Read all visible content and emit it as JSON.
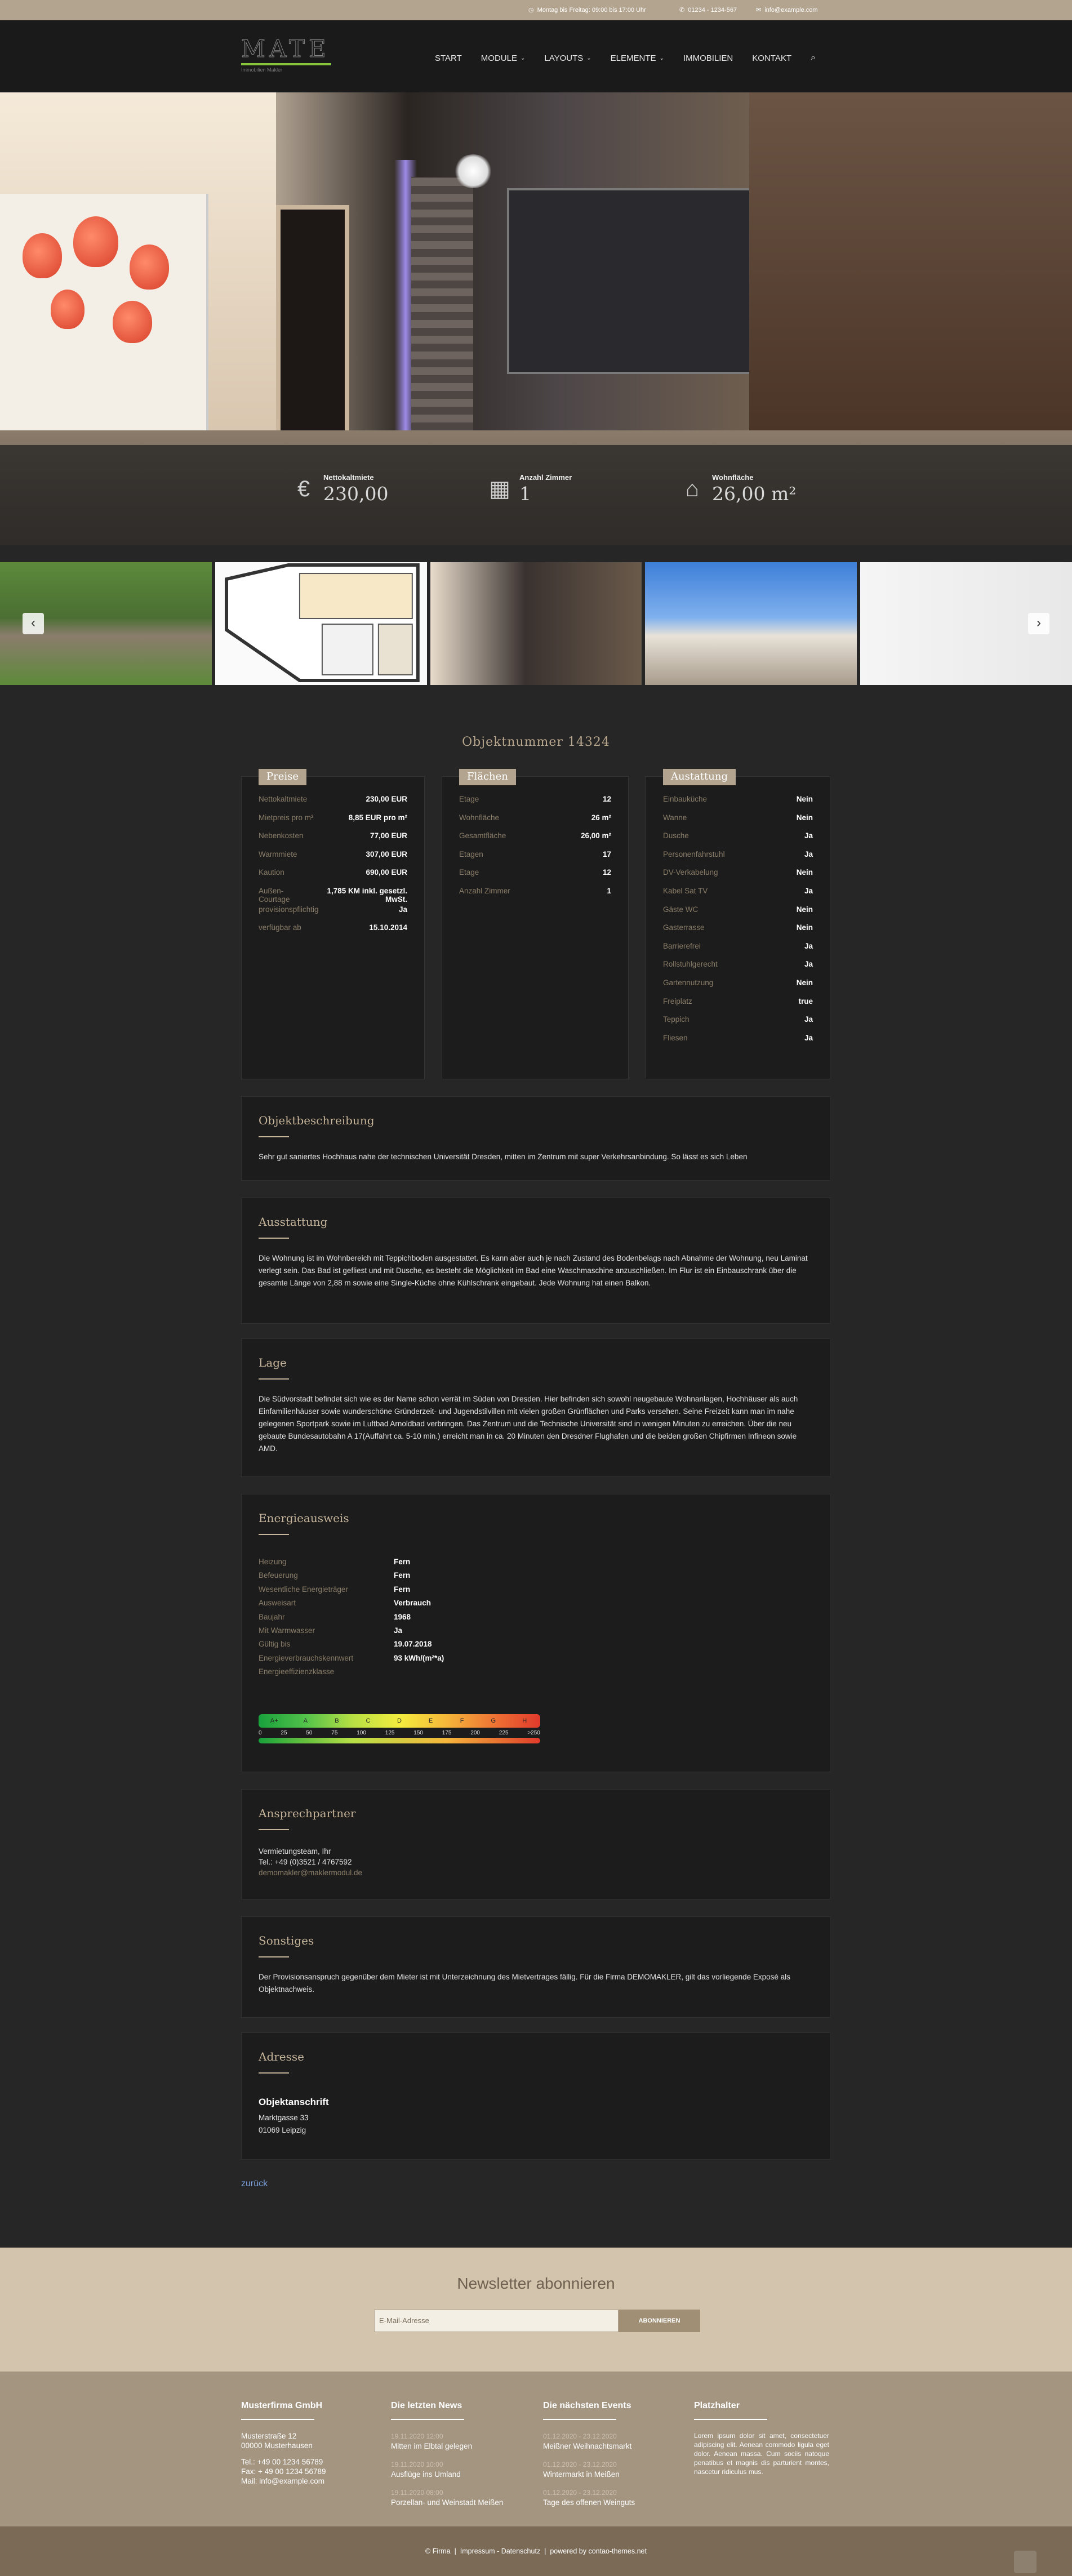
{
  "topbar": {
    "hours": "Montag bis Freitag: 09:00 bis 17:00 Uhr",
    "phone": "01234 - 1234-567",
    "email": "info@example.com"
  },
  "logo": {
    "text": "MATE",
    "tagline": "Immobilien Makler"
  },
  "nav": [
    "START",
    "MODULE",
    "LAYOUTS",
    "ELEMENTE",
    "IMMOBILIEN",
    "KONTAKT"
  ],
  "hero_stats": [
    {
      "label": "Nettokaltmiete",
      "value": "230,00"
    },
    {
      "label": "Anzahl Zimmer",
      "value": "1"
    },
    {
      "label": "Wohnfläche",
      "value": "26,00 m²"
    }
  ],
  "object_number": "Objektnummer 14324",
  "preise": {
    "title": "Preise",
    "rows": [
      {
        "k": "Nettokaltmiete",
        "v": "230,00 EUR"
      },
      {
        "k": "Mietpreis pro m²",
        "v": "8,85 EUR pro m²"
      },
      {
        "k": "Nebenkosten",
        "v": "77,00 EUR"
      },
      {
        "k": "Warmmiete",
        "v": "307,00 EUR"
      },
      {
        "k": "Kaution",
        "v": "690,00 EUR"
      },
      {
        "k": "Außen-Courtage",
        "v": "1,785 KM inkl. gesetzl. MwSt."
      },
      {
        "k": "provisionspflichtig",
        "v": "Ja"
      },
      {
        "k": "verfügbar ab",
        "v": "15.10.2014"
      }
    ]
  },
  "flaechen": {
    "title": "Flächen",
    "rows": [
      {
        "k": "Etage",
        "v": "12"
      },
      {
        "k": "Wohnfläche",
        "v": "26 m²"
      },
      {
        "k": "Gesamtfläche",
        "v": "26,00 m²"
      },
      {
        "k": "Etagen",
        "v": "17"
      },
      {
        "k": "Etage",
        "v": "12"
      },
      {
        "k": "Anzahl Zimmer",
        "v": "1"
      }
    ]
  },
  "ausstattung_box": {
    "title": "Austattung",
    "rows": [
      {
        "k": "Einbauküche",
        "v": "Nein"
      },
      {
        "k": "Wanne",
        "v": "Nein"
      },
      {
        "k": "Dusche",
        "v": "Ja"
      },
      {
        "k": "Personenfahrstuhl",
        "v": "Ja"
      },
      {
        "k": "DV-Verkabelung",
        "v": "Nein"
      },
      {
        "k": "Kabel Sat TV",
        "v": "Ja"
      },
      {
        "k": "Gäste WC",
        "v": "Nein"
      },
      {
        "k": "Gasterrasse",
        "v": "Nein"
      },
      {
        "k": "Barrierefrei",
        "v": "Ja"
      },
      {
        "k": "Rollstuhlgerecht",
        "v": "Ja"
      },
      {
        "k": "Gartennutzung",
        "v": "Nein"
      },
      {
        "k": "Freiplatz",
        "v": "true"
      },
      {
        "k": "Teppich",
        "v": "Ja"
      },
      {
        "k": "Fliesen",
        "v": "Ja"
      }
    ]
  },
  "sections": {
    "beschreibung": {
      "title": "Objektbeschreibung",
      "text": "Sehr gut saniertes Hochhaus nahe der technischen Universität Dresden, mitten im Zentrum mit super Verkehrsanbindung. So lässt es sich Leben"
    },
    "ausstattung": {
      "title": "Ausstattung",
      "text": "Die Wohnung ist im Wohnbereich mit Teppichboden ausgestattet. Es kann aber auch je nach Zustand des Bodenbelags nach Abnahme der Wohnung, neu Laminat verlegt sein. Das Bad ist gefliest und mit Dusche, es besteht die Möglichkeit im Bad eine Waschmaschine anzuschließen. Im Flur ist ein Einbauschrank über die gesamte Länge von 2,88 m sowie eine Single-Küche ohne Kühlschrank eingebaut. Jede Wohnung hat einen Balkon."
    },
    "lage": {
      "title": "Lage",
      "text": "Die Südvorstadt befindet sich wie es der Name schon verrät im Süden von Dresden. Hier befinden sich sowohl neugebaute Wohnanlagen, Hochhäuser als auch Einfamilienhäuser sowie wunderschöne Gründerzeit- und Jugendstilvillen mit vielen großen Grünflächen und Parks versehen. Seine Freizeit kann man im nahe gelegenen Sportpark sowie im Luftbad Arnoldbad verbringen. Das Zentrum und die Technische Universität sind in wenigen Minuten zu erreichen. Über die neu gebaute Bundesautobahn A 17(Auffahrt ca. 5-10 min.) erreicht man in ca. 20 Minuten den Dresdner Flughafen und die beiden großen Chipfirmen Infineon sowie AMD."
    },
    "energie": {
      "title": "Energieausweis",
      "rows": [
        {
          "k": "Heizung",
          "v": "Fern"
        },
        {
          "k": "Befeuerung",
          "v": "Fern"
        },
        {
          "k": "Wesentliche Energieträger",
          "v": "Fern"
        },
        {
          "k": "Ausweisart",
          "v": "Verbrauch"
        },
        {
          "k": "Baujahr",
          "v": "1968"
        },
        {
          "k": "Mit Warmwasser",
          "v": "Ja"
        },
        {
          "k": "Gültig bis",
          "v": "19.07.2018"
        },
        {
          "k": "Energieverbrauchskennwert",
          "v": "93 kWh/(m²*a)"
        },
        {
          "k": "Energieeffizienzklasse",
          "v": ""
        }
      ],
      "scale_classes": [
        "A+",
        "A",
        "B",
        "C",
        "D",
        "E",
        "F",
        "G",
        "H"
      ],
      "scale_numbers": [
        "0",
        "25",
        "50",
        "75",
        "100",
        "125",
        "150",
        "175",
        "200",
        "225",
        ">250"
      ],
      "marker_value": 93
    },
    "ansprechpartner": {
      "title": "Ansprechpartner",
      "name": "Vermietungsteam, Ihr",
      "tel": "Tel.: +49 (0)3521 / 4767592",
      "email": "demomakler@maklermodul.de"
    },
    "sonstiges": {
      "title": "Sonstiges",
      "text": "Der Provisionsanspruch gegenüber dem Mieter ist mit Unterzeichnung des Mietvertrages fällig. Für die Firma DEMOMAKLER, gilt das vorliegende Exposé als Objektnachweis."
    },
    "adresse": {
      "title": "Adresse",
      "heading": "Objektanschrift",
      "street": "Marktgasse 33",
      "city": "01069 Leipzig"
    }
  },
  "back_link": "zurück",
  "newsletter": {
    "title": "Newsletter abonnieren",
    "placeholder": "E-Mail-Adresse",
    "button": "ABONNIEREN"
  },
  "footer": {
    "company": {
      "title": "Musterfirma GmbH",
      "street": "Musterstraße 12",
      "city": "00000 Musterhausen",
      "tel": "Tel.: +49 00 1234 56789",
      "fax": "Fax: + 49 00 1234 56789",
      "mail": "Mail: info@example.com"
    },
    "news": {
      "title": "Die letzten News",
      "items": [
        {
          "date": "19.11.2020 12:00",
          "text": "Mitten im Elbtal gelegen"
        },
        {
          "date": "19.11.2020 10:00",
          "text": "Ausflüge ins Umland"
        },
        {
          "date": "19.11.2020 08:00",
          "text": "Porzellan- und Weinstadt Meißen"
        }
      ]
    },
    "events": {
      "title": "Die nächsten Events",
      "items": [
        {
          "date": "01.12.2020 - 23.12.2020",
          "text": "Meißner Weihnachtsmarkt"
        },
        {
          "date": "01.12.2020 - 23.12.2020",
          "text": "Wintermarkt in Meißen"
        },
        {
          "date": "01.12.2020 - 23.12.2020",
          "text": "Tage des offenen Weinguts"
        }
      ]
    },
    "placeholder": {
      "title": "Platzhalter",
      "text": "Lorem ipsum dolor sit amet, consectetuer adipiscing elit. Aenean commodo ligula eget dolor. Aenean massa. Cum sociis natoque penatibus et magnis dis parturient montes, nascetur ridiculus mus."
    }
  },
  "bottom": {
    "firma": "© Firma",
    "impressum": "Impressum - Datenschutz",
    "powered": "powered by contao-themes.net"
  }
}
